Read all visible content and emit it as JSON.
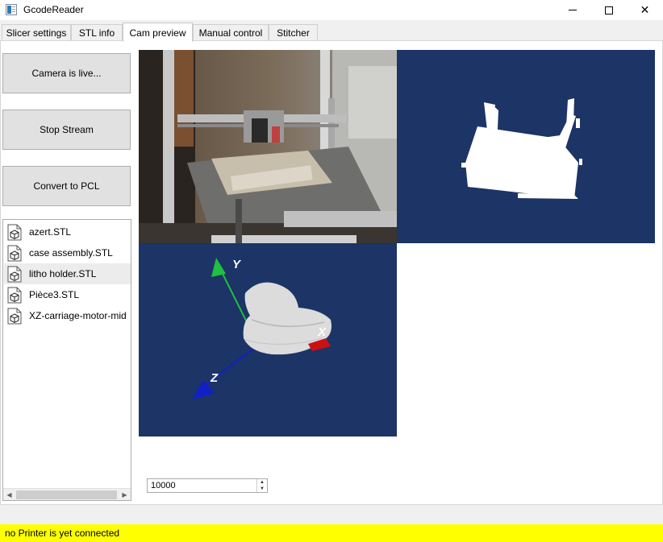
{
  "window": {
    "title": "GcodeReader",
    "minimize": "—",
    "maximize": "☐",
    "close": "✕"
  },
  "tabs": [
    {
      "label": "Slicer settings",
      "active": false
    },
    {
      "label": "STL info",
      "active": false
    },
    {
      "label": "Cam preview",
      "active": true
    },
    {
      "label": "Manual control",
      "active": false
    },
    {
      "label": "Stitcher",
      "active": false
    }
  ],
  "buttons": {
    "camera": "Camera is live...",
    "stop_stream": "Stop Stream",
    "convert": "Convert to PCL"
  },
  "files": [
    {
      "name": "azert.STL",
      "icon": "stl-file-icon",
      "selected": false
    },
    {
      "name": "case assembly.STL",
      "icon": "stl-file-icon",
      "selected": false
    },
    {
      "name": "litho holder.STL",
      "icon": "stl-file-icon",
      "selected": true
    },
    {
      "name": "Pièce3.STL",
      "icon": "stl-file-icon",
      "selected": false
    },
    {
      "name": "XZ-carriage-motor-mid",
      "icon": "stl-file-icon",
      "selected": false
    }
  ],
  "axes": {
    "x": "X",
    "y": "Y",
    "z": "Z"
  },
  "spinbox": {
    "value": "10000"
  },
  "status": {
    "text": "no Printer is yet connected"
  },
  "colors": {
    "view_bg": "#1c3466",
    "status_bg": "#ffff00",
    "axis_x": "#cc1010",
    "axis_y": "#20c040",
    "axis_z": "#1020c8"
  }
}
